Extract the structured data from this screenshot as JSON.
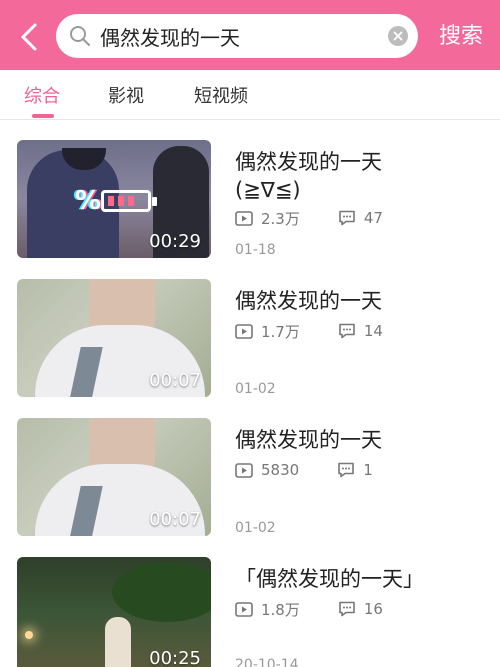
{
  "header": {
    "search_query": "偶然发现的一天",
    "search_button": "搜索",
    "accent_color": "#f36a9a"
  },
  "tabs": [
    {
      "label": "综合",
      "active": true
    },
    {
      "label": "影视",
      "active": false
    },
    {
      "label": "短视频",
      "active": false
    }
  ],
  "results": [
    {
      "title": "偶然发现的一天\n(≧∇≦)",
      "duration": "00:29",
      "plays": "2.3万",
      "comments": "47",
      "date": "01-18"
    },
    {
      "title": "偶然发现的一天",
      "duration": "00:07",
      "plays": "1.7万",
      "comments": "14",
      "date": "01-02"
    },
    {
      "title": "偶然发现的一天",
      "duration": "00:07",
      "plays": "5830",
      "comments": "1",
      "date": "01-02"
    },
    {
      "title": "「偶然发现的一天」",
      "duration": "00:25",
      "plays": "1.8万",
      "comments": "16",
      "date": "20-10-14"
    }
  ],
  "icons": [
    "back-arrow-icon",
    "search-icon",
    "clear-icon",
    "play-count-icon",
    "comment-icon"
  ]
}
